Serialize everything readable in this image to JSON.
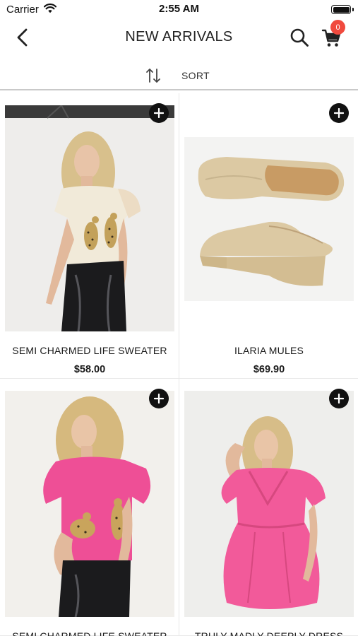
{
  "status_bar": {
    "carrier": "Carrier",
    "time": "2:55 AM"
  },
  "nav": {
    "title": "NEW ARRIVALS",
    "cart_count": "0"
  },
  "sort": {
    "label": "SORT"
  },
  "products": [
    {
      "name": "SEMI CHARMED LIFE SWEATER",
      "price": "$58.00",
      "image": "model in cream leopard tee, black leather pants"
    },
    {
      "name": "ILARIA MULES",
      "price": "$69.90",
      "image": "woven raffia wedge mules"
    },
    {
      "name": "SEMI CHARMED LIFE SWEATER",
      "price": "",
      "image": "model in pink leopard tee, black leather pants"
    },
    {
      "name": "TRULY MADLY DEEPLY DRESS",
      "price": "",
      "image": "model in pink puff-sleeve dress"
    }
  ],
  "colors": {
    "badge": "#f04a3e",
    "divider": "#c9c9c9",
    "pink": "#ee4f96"
  },
  "icons": [
    "chevron-left-icon",
    "search-icon",
    "cart-icon",
    "sort-arrows-icon",
    "plus-icon",
    "wifi-icon",
    "battery-icon"
  ]
}
